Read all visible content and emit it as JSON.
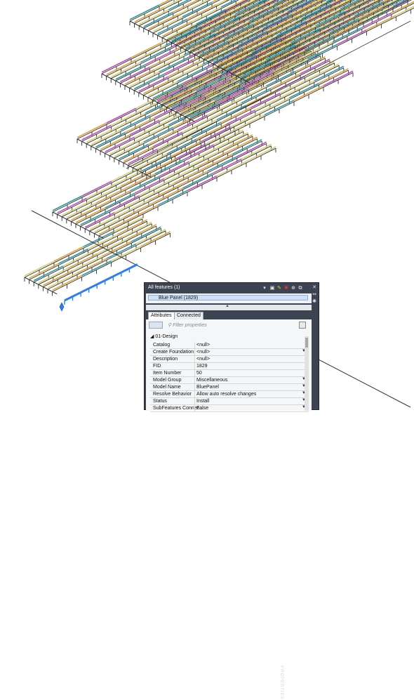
{
  "canvas": {
    "colors": {
      "yellow": "#d8d270",
      "teal": "#2a9aa0",
      "magenta": "#c44bb8",
      "orange": "#e0a23a",
      "frame": "#2b2b2b",
      "select": "#2f7ef0"
    }
  },
  "panel": {
    "title": "All features (1)",
    "selected_feature": "Blue Panel (1829)",
    "tabs": [
      {
        "label": "Attributes"
      },
      {
        "label": "Connected"
      }
    ],
    "filter_placeholder": "Filter properties",
    "group_label": "01-Design",
    "rows": [
      {
        "key": "Catalog",
        "value": "<null>"
      },
      {
        "key": "Create Foundation",
        "value": "<null>",
        "has_dropdown": true
      },
      {
        "key": "Description",
        "value": "<null>"
      },
      {
        "key": "FID",
        "value": "1829"
      },
      {
        "key": "Item Number",
        "value": "50"
      },
      {
        "key": "Model Group",
        "value": "Miscellaneous",
        "has_dropdown": true
      },
      {
        "key": "Model Name",
        "value": "BluePanel",
        "has_dropdown": true
      },
      {
        "key": "Resolve Behavior",
        "value": "Allow auto resolve changes",
        "has_dropdown": true
      },
      {
        "key": "Status",
        "value": "Install",
        "has_dropdown": true
      },
      {
        "key": "SubFeatures Connec...",
        "value": "False",
        "has_dropdown": true
      }
    ],
    "side_label": "PROPERTIES",
    "icons": [
      "chevron-down-icon",
      "copy-icon",
      "highlight-icon",
      "delete-icon",
      "zoom-icon",
      "copy-selection-icon",
      "close-icon",
      "pin-icon",
      "settings-icon",
      "collapse-up-icon",
      "filter-icon",
      "sort-icon",
      "grid-toggle-icon",
      "picker-icon"
    ]
  }
}
